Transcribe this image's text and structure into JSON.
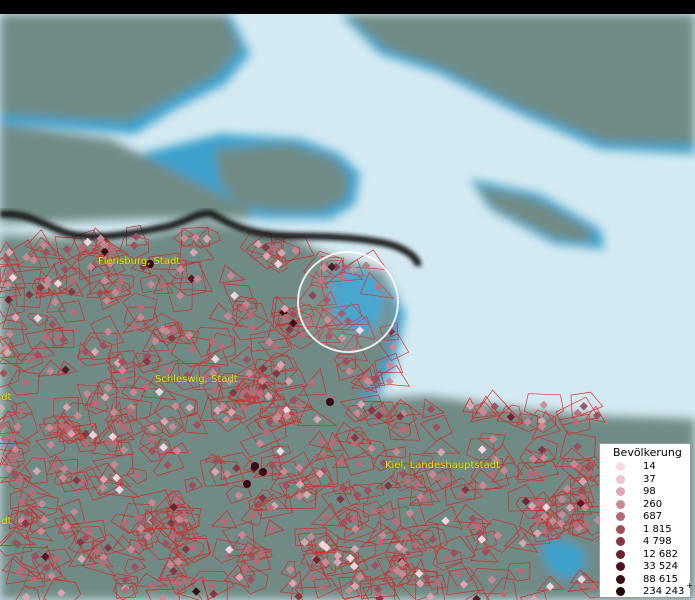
{
  "map": {
    "colors": {
      "land": "#6f8b85",
      "land_dark": "#5f7d77",
      "water": "#d4eaf2",
      "shore": "#3aa0cc",
      "boundary": "#e02020",
      "border": "#1a1a1a"
    },
    "labels": [
      {
        "id": "flensburg",
        "text": "Flensburg, Stadt"
      },
      {
        "id": "schleswig",
        "text": "Schleswig, Stadt"
      },
      {
        "id": "kiel",
        "text": "Kiel, Landeshauptstadt"
      },
      {
        "id": "west-1",
        "text": "stadt"
      },
      {
        "id": "west-2",
        "text": "stadt"
      }
    ]
  },
  "legend": {
    "title": "Bevölkerung",
    "items": [
      {
        "label": "14",
        "color": "#f7dbe3"
      },
      {
        "label": "37",
        "color": "#edc3cd"
      },
      {
        "label": "98",
        "color": "#dea7b2"
      },
      {
        "label": "260",
        "color": "#cc8893"
      },
      {
        "label": "687",
        "color": "#b76b77"
      },
      {
        "label": "1 815",
        "color": "#9f4e5c"
      },
      {
        "label": "4 798",
        "color": "#863543"
      },
      {
        "label": "12 682",
        "color": "#6c2130"
      },
      {
        "label": "33 524",
        "color": "#521320"
      },
      {
        "label": "88 615",
        "color": "#380a13"
      },
      {
        "label": "234 243",
        "color": "#1f0408"
      }
    ],
    "plus_marker": "+"
  }
}
